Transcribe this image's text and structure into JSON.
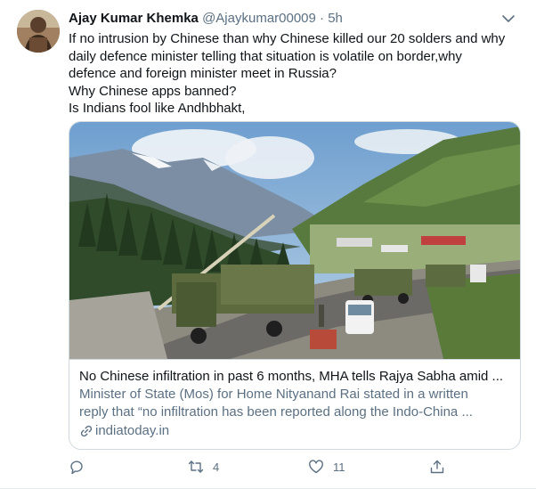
{
  "tweet": {
    "author_name": "Ajay Kumar Khemka",
    "handle": "@Ajaykumar00009",
    "separator": "·",
    "time": "5h",
    "lines": [
      "If no intrusion by Chinese than why Chinese killed our 20 solders and why",
      "daily defence minister telling that situation is volatile on border,why",
      "defence and foreign minister meet in Russia?",
      "Why Chinese apps banned?",
      "Is Indians fool like Andhbhakt,"
    ]
  },
  "card": {
    "title": "No Chinese infiltration in past 6 months, MHA tells Rajya Sabha amid ...",
    "description_lines": [
      "Minister of State (Mos) for Home Nityanand Rai stated in a written",
      "reply that “no infiltration has been reported along the Indo-China ..."
    ],
    "domain": "indiatoday.in"
  },
  "actions": {
    "reply_count": "",
    "retweet_count": "4",
    "like_count": "11"
  },
  "colors": {
    "secondary_text": "#5b7083",
    "primary_text": "#0f1419",
    "border": "#cfd9de"
  },
  "icons": [
    "avatar-photo",
    "chevron-down-icon",
    "link-icon",
    "reply-icon",
    "retweet-icon",
    "like-icon",
    "share-icon"
  ]
}
